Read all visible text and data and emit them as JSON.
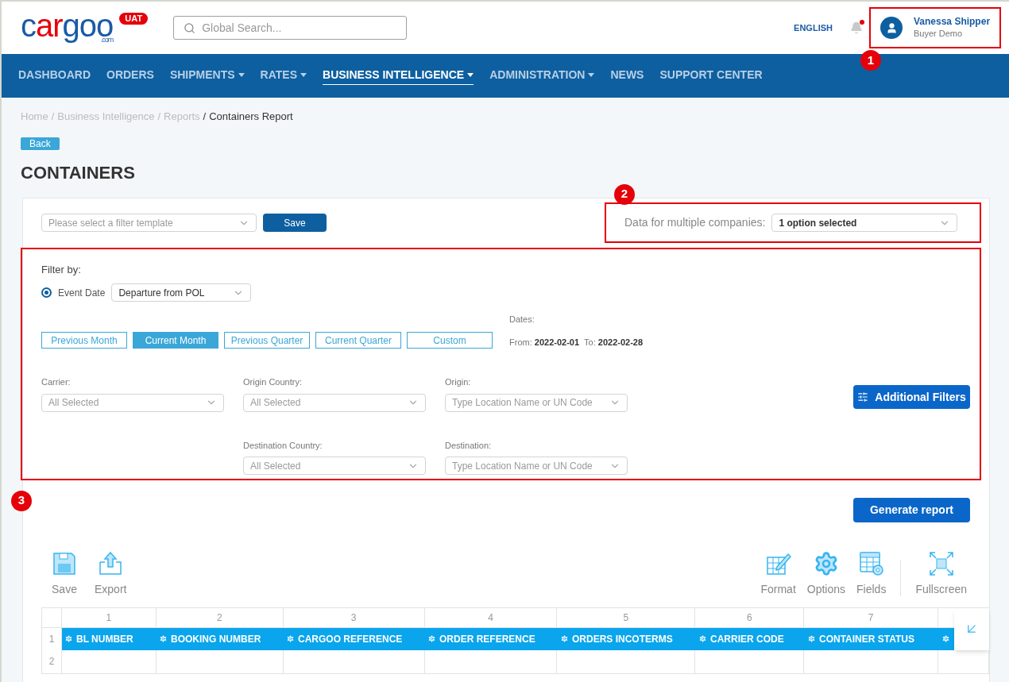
{
  "header": {
    "logo": {
      "start": "c",
      "accent": "ar",
      "end": "goo",
      "suffix": ".com"
    },
    "env_badge": "UAT",
    "search": {
      "placeholder": "Global Search..."
    },
    "language": "ENGLISH",
    "notifications": {
      "unread": true
    },
    "user": {
      "name": "Vanessa Shipper",
      "company": "Buyer Demo"
    }
  },
  "nav": [
    {
      "label": "DASHBOARD",
      "has_menu": false,
      "selected": false
    },
    {
      "label": "ORDERS",
      "has_menu": false,
      "selected": false
    },
    {
      "label": "SHIPMENTS",
      "has_menu": true,
      "selected": false
    },
    {
      "label": "RATES",
      "has_menu": true,
      "selected": false
    },
    {
      "label": "BUSINESS INTELLIGENCE",
      "has_menu": true,
      "selected": true
    },
    {
      "label": "ADMINISTRATION",
      "has_menu": true,
      "selected": false
    },
    {
      "label": "NEWS",
      "has_menu": false,
      "selected": false
    },
    {
      "label": "SUPPORT CENTER",
      "has_menu": false,
      "selected": false
    }
  ],
  "breadcrumb": [
    "Home",
    "Business Intelligence",
    "Reports",
    "Containers Report"
  ],
  "breadcrumb_separator": "/",
  "back_button": "Back",
  "title": "CONTAINERS",
  "template": {
    "placeholder": "Please select a filter template",
    "save_button": "Save"
  },
  "companies": {
    "label": "Data for multiple companies:",
    "value": "1 option selected"
  },
  "filter": {
    "heading": "Filter by:",
    "event_date": {
      "label": "Event Date",
      "checked": true,
      "value": "Departure from POL"
    },
    "periods": [
      {
        "label": "Previous Month",
        "selected": false
      },
      {
        "label": "Current Month",
        "selected": true
      },
      {
        "label": "Previous Quarter",
        "selected": false
      },
      {
        "label": "Current Quarter",
        "selected": false
      },
      {
        "label": "Custom",
        "selected": false
      }
    ],
    "dates": {
      "label": "Dates:",
      "from_label": "From:",
      "from": "2022-02-01",
      "to_label": "To:",
      "to": "2022-02-28"
    },
    "rows": [
      {
        "fields": [
          {
            "label": "Carrier:",
            "placeholder": "All Selected"
          },
          {
            "label": "Origin Country:",
            "placeholder": "All Selected"
          },
          {
            "label": "Origin:",
            "placeholder": "Type Location Name or UN Code"
          }
        ]
      },
      {
        "fields": [
          {
            "label": "Destination Country:",
            "placeholder": "All Selected"
          },
          {
            "label": "Destination:",
            "placeholder": "Type Location Name or UN Code"
          }
        ]
      }
    ],
    "additional_filters": "Additional Filters"
  },
  "annotations": [
    "1",
    "2",
    "3"
  ],
  "generate_button": "Generate report",
  "toolbar": {
    "left": [
      {
        "kind": "save",
        "label": "Save"
      },
      {
        "kind": "export",
        "label": "Export"
      }
    ],
    "right": [
      {
        "kind": "format",
        "label": "Format"
      },
      {
        "kind": "options",
        "label": "Options"
      },
      {
        "kind": "fields",
        "label": "Fields"
      },
      {
        "kind": "fullscreen",
        "label": "Fullscreen"
      }
    ]
  },
  "grid": {
    "row_numbers": [
      "1",
      "2"
    ],
    "columns": [
      {
        "kind": "full",
        "number": "1",
        "header": "BL NUMBER"
      },
      {
        "kind": "full",
        "number": "2",
        "header": "BOOKING NUMBER"
      },
      {
        "kind": "full",
        "number": "3",
        "header": "CARGOO REFERENCE"
      },
      {
        "kind": "full",
        "number": "4",
        "header": "ORDER REFERENCE"
      },
      {
        "kind": "full",
        "number": "5",
        "header": "ORDERS INCOTERMS"
      },
      {
        "kind": "full",
        "number": "6",
        "header": "CARRIER CODE"
      },
      {
        "kind": "full",
        "number": "7",
        "header": "CONTAINER STATUS"
      },
      {
        "kind": "covered"
      }
    ]
  }
}
